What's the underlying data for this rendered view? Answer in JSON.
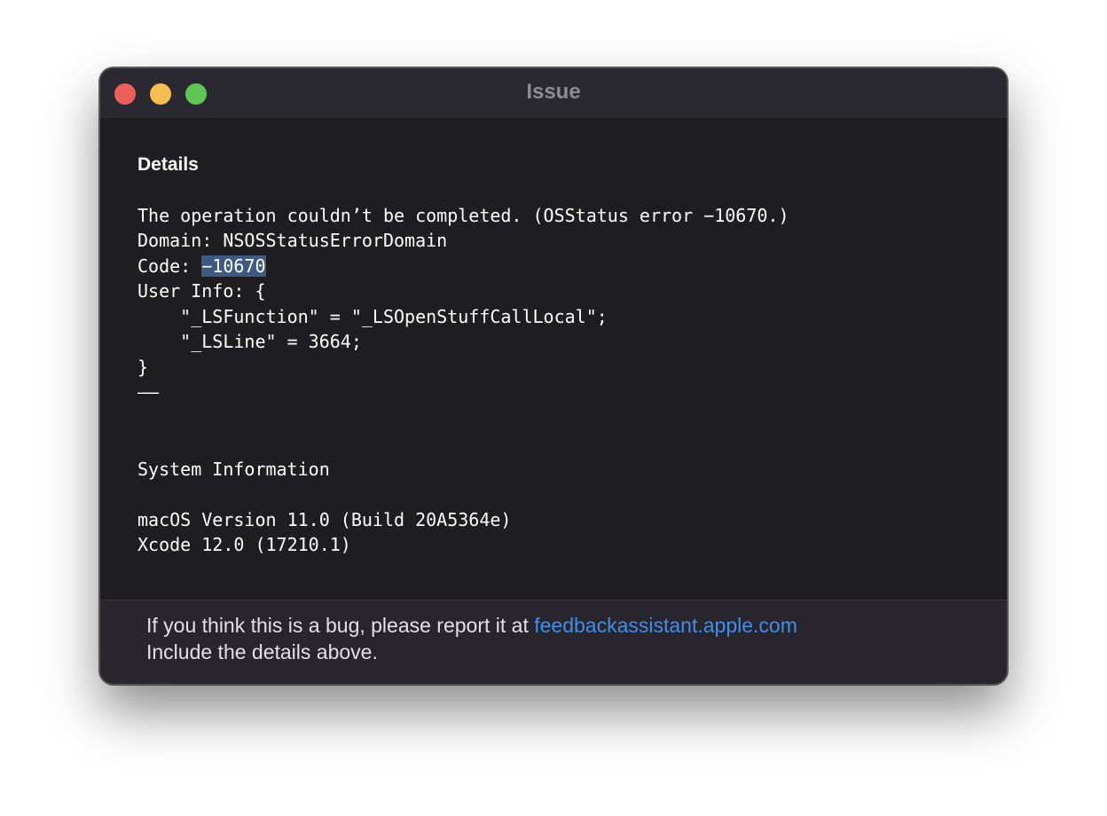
{
  "window": {
    "title": "Issue",
    "traffic_lights": {
      "close_color": "#ec5f58",
      "minimize_color": "#f4bf4f",
      "zoom_color": "#60c754"
    }
  },
  "details": {
    "heading": "Details",
    "error_line": "The operation couldn’t be completed. (OSStatus error −10670.)",
    "domain_line": "Domain: NSOSStatusErrorDomain",
    "code_prefix": "Code: ",
    "code_value": "−10670",
    "user_info_open": "User Info: {",
    "user_info_function": "    \"_LSFunction\" = \"_LSOpenStuffCallLocal\";",
    "user_info_line": "    \"_LSLine\" = 3664;",
    "user_info_close": "}",
    "separator": "––"
  },
  "system_info": {
    "heading": "System Information",
    "macos": "macOS Version 11.0 (Build 20A5364e)",
    "xcode": "Xcode 12.0 (17210.1)"
  },
  "footer": {
    "text": "If you think this is a bug, please report it at ",
    "link": "feedbackassistant.apple.com",
    "line2": "Include the details above."
  },
  "colors": {
    "link": "#3f8fef",
    "selection": "#3d5a80",
    "background": "#1e1e20"
  }
}
